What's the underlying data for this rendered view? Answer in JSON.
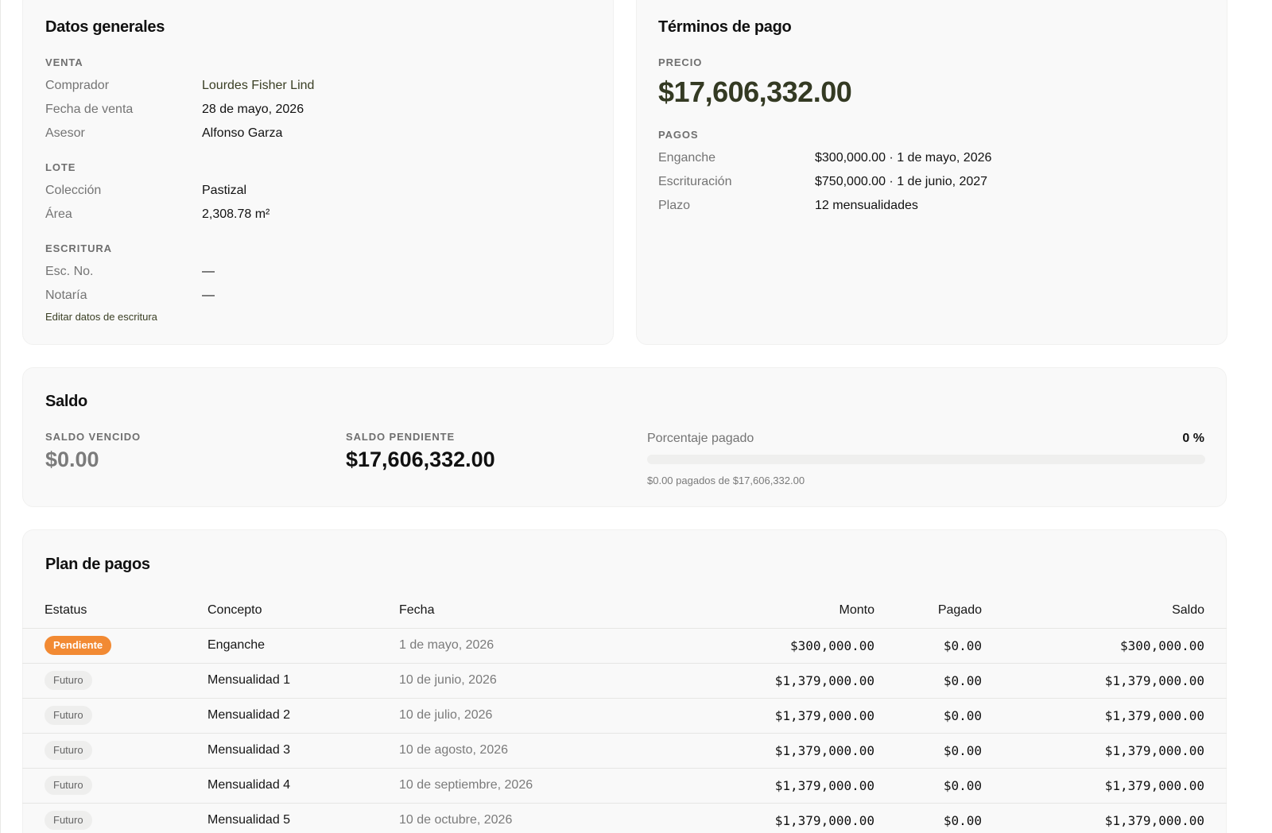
{
  "general": {
    "title": "Datos generales",
    "venta": {
      "label": "VENTA",
      "rows": [
        {
          "label": "Comprador",
          "value": "Lourdes Fisher Lind"
        },
        {
          "label": "Fecha de venta",
          "value": "28 de mayo, 2026"
        },
        {
          "label": "Asesor",
          "value": "Alfonso Garza"
        }
      ]
    },
    "lote": {
      "label": "LOTE",
      "rows": [
        {
          "label": "Colección",
          "value": "Pastizal"
        },
        {
          "label": "Área",
          "value": "2,308.78 m²"
        }
      ]
    },
    "escritura": {
      "label": "ESCRITURA",
      "rows": [
        {
          "label": "Esc. No.",
          "value": "—"
        },
        {
          "label": "Notaría",
          "value": "—"
        }
      ],
      "edit_link": "Editar datos de escritura"
    }
  },
  "terms": {
    "title": "Términos de pago",
    "precio_label": "PRECIO",
    "precio_value": "$17,606,332.00",
    "pagos_label": "PAGOS",
    "rows": [
      {
        "label": "Enganche",
        "value": "$300,000.00 · 1 de mayo, 2026"
      },
      {
        "label": "Escrituración",
        "value": "$750,000.00 · 1 de junio, 2027"
      },
      {
        "label": "Plazo",
        "value": "12 mensualidades"
      }
    ]
  },
  "saldo": {
    "title": "Saldo",
    "vencido_label": "SALDO VENCIDO",
    "vencido_value": "$0.00",
    "pendiente_label": "SALDO PENDIENTE",
    "pendiente_value": "$17,606,332.00",
    "porcentaje_label": "Porcentaje pagado",
    "porcentaje_value": "0 %",
    "porcentaje_fraction": 0,
    "caption": "$0.00 pagados de $17,606,332.00"
  },
  "plan": {
    "title": "Plan de pagos",
    "columns": {
      "estatus": "Estatus",
      "concepto": "Concepto",
      "fecha": "Fecha",
      "monto": "Monto",
      "pagado": "Pagado",
      "saldo": "Saldo"
    },
    "rows": [
      {
        "status": "Pendiente",
        "concept": "Enganche",
        "date": "1 de mayo, 2026",
        "monto": "$300,000.00",
        "pagado": "$0.00",
        "saldo": "$300,000.00"
      },
      {
        "status": "Futuro",
        "concept": "Mensualidad 1",
        "date": "10 de junio, 2026",
        "monto": "$1,379,000.00",
        "pagado": "$0.00",
        "saldo": "$1,379,000.00"
      },
      {
        "status": "Futuro",
        "concept": "Mensualidad 2",
        "date": "10 de julio, 2026",
        "monto": "$1,379,000.00",
        "pagado": "$0.00",
        "saldo": "$1,379,000.00"
      },
      {
        "status": "Futuro",
        "concept": "Mensualidad 3",
        "date": "10 de agosto, 2026",
        "monto": "$1,379,000.00",
        "pagado": "$0.00",
        "saldo": "$1,379,000.00"
      },
      {
        "status": "Futuro",
        "concept": "Mensualidad 4",
        "date": "10 de septiembre, 2026",
        "monto": "$1,379,000.00",
        "pagado": "$0.00",
        "saldo": "$1,379,000.00"
      },
      {
        "status": "Futuro",
        "concept": "Mensualidad 5",
        "date": "10 de octubre, 2026",
        "monto": "$1,379,000.00",
        "pagado": "$0.00",
        "saldo": "$1,379,000.00"
      }
    ]
  },
  "colors": {
    "accent": "#343a23",
    "pending": "#f28a33",
    "card_bg": "#f9f9f9"
  }
}
